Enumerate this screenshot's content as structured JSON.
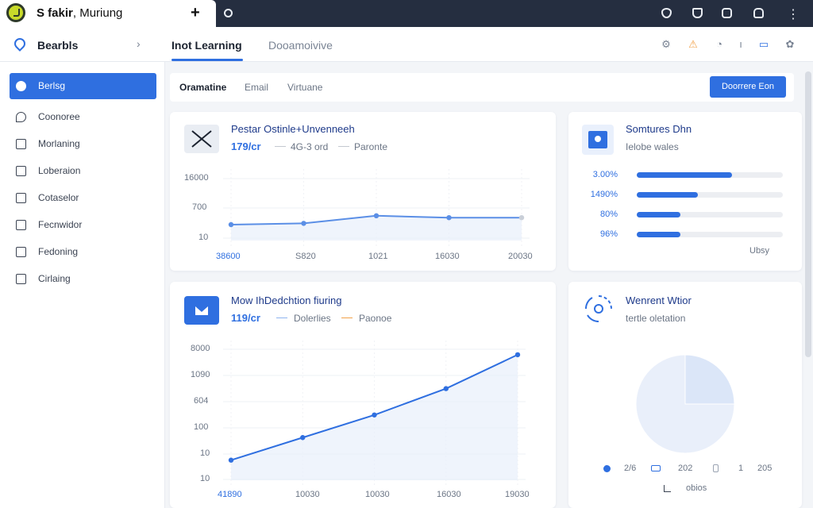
{
  "titlebar": {
    "app_name_bold": "S fakir",
    "app_name_rest": ", Muriung",
    "new_tab": "+",
    "more": "⋮"
  },
  "header": {
    "brand": "Bearbls",
    "chevron": "›",
    "nav_active": "Inot Learning",
    "nav_inactive": "Dooamoivive",
    "icon_glyphs": [
      "⚙",
      "⚠",
      "◔",
      "ı",
      "▭",
      "✿"
    ]
  },
  "sidebar": {
    "items": [
      {
        "label": "Berlsg",
        "icon": "chat-icon",
        "active": true
      },
      {
        "label": "Coonoree",
        "icon": "location-icon"
      },
      {
        "label": "Morlaning",
        "icon": "document-icon"
      },
      {
        "label": "Loberaion",
        "icon": "list-icon"
      },
      {
        "label": "Cotaselor",
        "icon": "table-icon"
      },
      {
        "label": "Fecnwidor",
        "icon": "calendar-icon"
      },
      {
        "label": "Fedoning",
        "icon": "edit-icon"
      },
      {
        "label": "Cirlaing",
        "icon": "window-icon"
      }
    ]
  },
  "subtabs": {
    "items": [
      "Oramatine",
      "Email",
      "Virtuane"
    ],
    "action_button": "Doorrere Eon"
  },
  "card1": {
    "title": "Pestar Ostinle+Unvenneeh",
    "value": "179/cr",
    "legend": [
      "4G-3 ord",
      "Paronte"
    ],
    "y_ticks": [
      "16000",
      "700",
      "10"
    ],
    "x_ticks": [
      "38600",
      "S820",
      "1021",
      "16030",
      "20030"
    ]
  },
  "card2": {
    "title": "Somtures Dhn",
    "subtitle": "Ielobe wales",
    "rows": [
      {
        "label": "3.00%",
        "value": 0.65
      },
      {
        "label": "1490%",
        "value": 0.42
      },
      {
        "label": "80%",
        "value": 0.3
      },
      {
        "label": "96%",
        "value": 0.3
      }
    ],
    "footer": "Ubsy"
  },
  "card3": {
    "title": "Mow IhDedchtion fiuring",
    "value": "119/cr",
    "legend": [
      "Dolerlies",
      "Paonoe"
    ],
    "y_ticks": [
      "8000",
      "1090",
      "604",
      "100",
      "10",
      "10"
    ],
    "x_ticks": [
      "41890",
      "10030",
      "10030",
      "16030",
      "19030"
    ]
  },
  "card4": {
    "title": "Wenrent Wtior",
    "subtitle": "tertle oletation",
    "legend": [
      "2/6",
      "202",
      "1",
      "205"
    ],
    "footer_label": "obios"
  },
  "colors": {
    "accent": "#2f6fe0",
    "titlebar": "#252e40",
    "title_blue": "#1e3a8a",
    "legend_orange": "#f2a24a",
    "legend_blue": "#8fb4f0"
  },
  "chart_data": [
    {
      "type": "line",
      "title": "Pestar Ostinle+Unvenneeh",
      "xlabel": "",
      "ylabel": "",
      "categories": [
        "38600",
        "S820",
        "1021",
        "16030",
        "20030"
      ],
      "yticks": [
        "10",
        "700",
        "16000"
      ],
      "values": [
        0.25,
        0.27,
        0.39,
        0.36,
        0.36
      ],
      "ylim": [
        0,
        1
      ],
      "grid": true
    },
    {
      "type": "bar",
      "title": "Somtures Dhn",
      "categories": [
        "3.00%",
        "1490%",
        "80%",
        "96%"
      ],
      "values": [
        0.65,
        0.42,
        0.3,
        0.3
      ],
      "ylim": [
        0,
        1
      ]
    },
    {
      "type": "line",
      "title": "Mow IhDedchtion fiuring",
      "xlabel": "",
      "ylabel": "",
      "categories": [
        "41890",
        "10030",
        "10030",
        "16030",
        "19030"
      ],
      "yticks": [
        "10",
        "10",
        "100",
        "604",
        "1090",
        "8000"
      ],
      "values": [
        0.16,
        0.34,
        0.52,
        0.73,
        1.0
      ],
      "ylim": [
        0,
        1.05
      ],
      "grid": true
    },
    {
      "type": "pie",
      "title": "Wenrent Wtior",
      "values": [
        0.25,
        0.75
      ]
    }
  ]
}
